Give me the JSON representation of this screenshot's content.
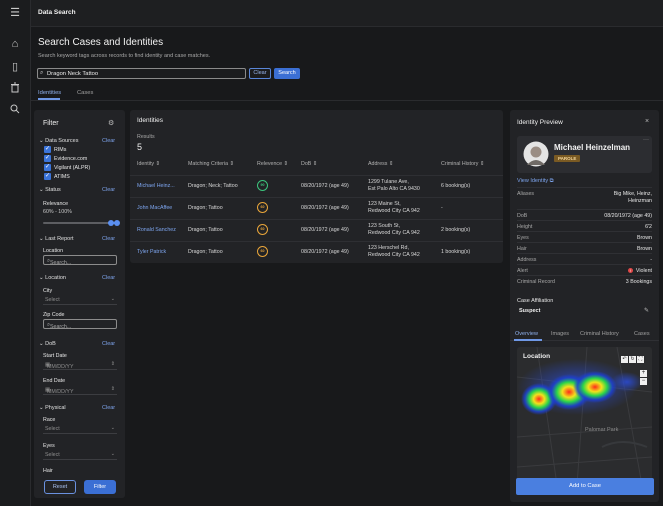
{
  "app": {
    "title": "Data Search"
  },
  "page": {
    "title": "Search Cases and Identities",
    "subtitle": "Search keyword tags across records to find identity and case matches."
  },
  "search": {
    "value": "Dragon Neck Tattoo",
    "clear_label": "Clear",
    "search_label": "Search"
  },
  "tabs": [
    {
      "label": "Identities",
      "active": true
    },
    {
      "label": "Cases",
      "active": false
    }
  ],
  "filter": {
    "title": "Filter",
    "data_sources": {
      "label": "Data Sources",
      "clear": "Clear",
      "items": [
        "RIMs",
        "Evidence.com",
        "Vigilant (ALPR)",
        "ATIMS"
      ]
    },
    "status": {
      "label": "Status",
      "clear": "Clear",
      "relevance_label": "Relevance",
      "relevance_value": "60% - 100%",
      "relevance_min": 0.6,
      "relevance_max": 1.0
    },
    "last_report": {
      "label": "Last Report",
      "clear": "Clear",
      "location_label": "Location",
      "location_placeholder": "Search..."
    },
    "location": {
      "label": "Location",
      "clear": "Clear",
      "city_label": "City",
      "city_value": "Select",
      "zip_label": "Zip Code",
      "zip_placeholder": "Search..."
    },
    "dob": {
      "label": "DoB",
      "clear": "Clear",
      "start_label": "Start Date",
      "start_placeholder": "MM/DD/YY",
      "end_label": "End Date",
      "end_placeholder": "MM/DD/YY"
    },
    "physical": {
      "label": "Physical",
      "clear": "Clear",
      "race_label": "Race",
      "race_value": "Select",
      "eyes_label": "Eyes",
      "eyes_value": "Select",
      "hair_label": "Hair"
    },
    "reset_label": "Reset",
    "filter_label": "Filter"
  },
  "identities": {
    "title": "Identities",
    "results_label": "Results",
    "results_count": "5",
    "columns": [
      "Identity",
      "Matching Criteria",
      "Relevence",
      "DoB",
      "Address",
      "Criminal History"
    ],
    "rows": [
      {
        "name": "Michael Heinz...",
        "criteria": "Dragon; Neck; Tattoo",
        "relevance": "90",
        "relevance_color": "#3cc47c",
        "dob": "08/20/1972 (age 49)",
        "address1": "1299 Tulane Ave,",
        "address2": "Est Palo Alto CA 9430",
        "history": "6 booking(s)"
      },
      {
        "name": "John MacAffee",
        "criteria": "Dragon; Tattoo",
        "relevance": "60",
        "relevance_color": "#e8a53a",
        "dob": "08/20/1972 (age 49)",
        "address1": "123 Maine St,",
        "address2": "Redwood City CA 942",
        "history": "-"
      },
      {
        "name": "Ronald Sanchez",
        "criteria": "Dragon; Tattoo",
        "relevance": "60",
        "relevance_color": "#e8a53a",
        "dob": "08/20/1972 (age 49)",
        "address1": "123 South St,",
        "address2": "Redwood City CA 942",
        "history": "2 booking(s)"
      },
      {
        "name": "Tyler Patrick",
        "criteria": "Dragon; Tattoo",
        "relevance": "60",
        "relevance_color": "#e8a53a",
        "dob": "08/20/1972 (age 49)",
        "address1": "123 Herschel Rd,",
        "address2": "Redwood City CA 942",
        "history": "1 booking(s)"
      }
    ]
  },
  "preview": {
    "title": "Identity Preview",
    "name": "Michael Heinzelman",
    "badge": "PAROLE",
    "view_identity": "View Identity",
    "fields": [
      {
        "k": "Aliases",
        "v": "Big Mike, Heinz, Heinzman"
      },
      {
        "k": "DoB",
        "v": "08/20/1972 (age 49)"
      },
      {
        "k": "Height",
        "v": "6'2"
      },
      {
        "k": "Eyes",
        "v": "Brown"
      },
      {
        "k": "Hair",
        "v": "Brown"
      },
      {
        "k": "Address",
        "v": "-"
      },
      {
        "k": "Alert",
        "v": "Violent"
      },
      {
        "k": "Criminal Record",
        "v": "3 Bookings"
      }
    ],
    "affiliation_label": "Case Affiliation",
    "affiliation_value": "Suspect",
    "tabs": [
      "Overview",
      "Images",
      "Criminal History",
      "Cases"
    ],
    "map_title": "Location",
    "map_place": "Palomar Park",
    "add_case": "Add to Case",
    "colors": {
      "accent": "#3b6fd4",
      "alert": "#e04848",
      "badge": "#7a5a23"
    }
  }
}
